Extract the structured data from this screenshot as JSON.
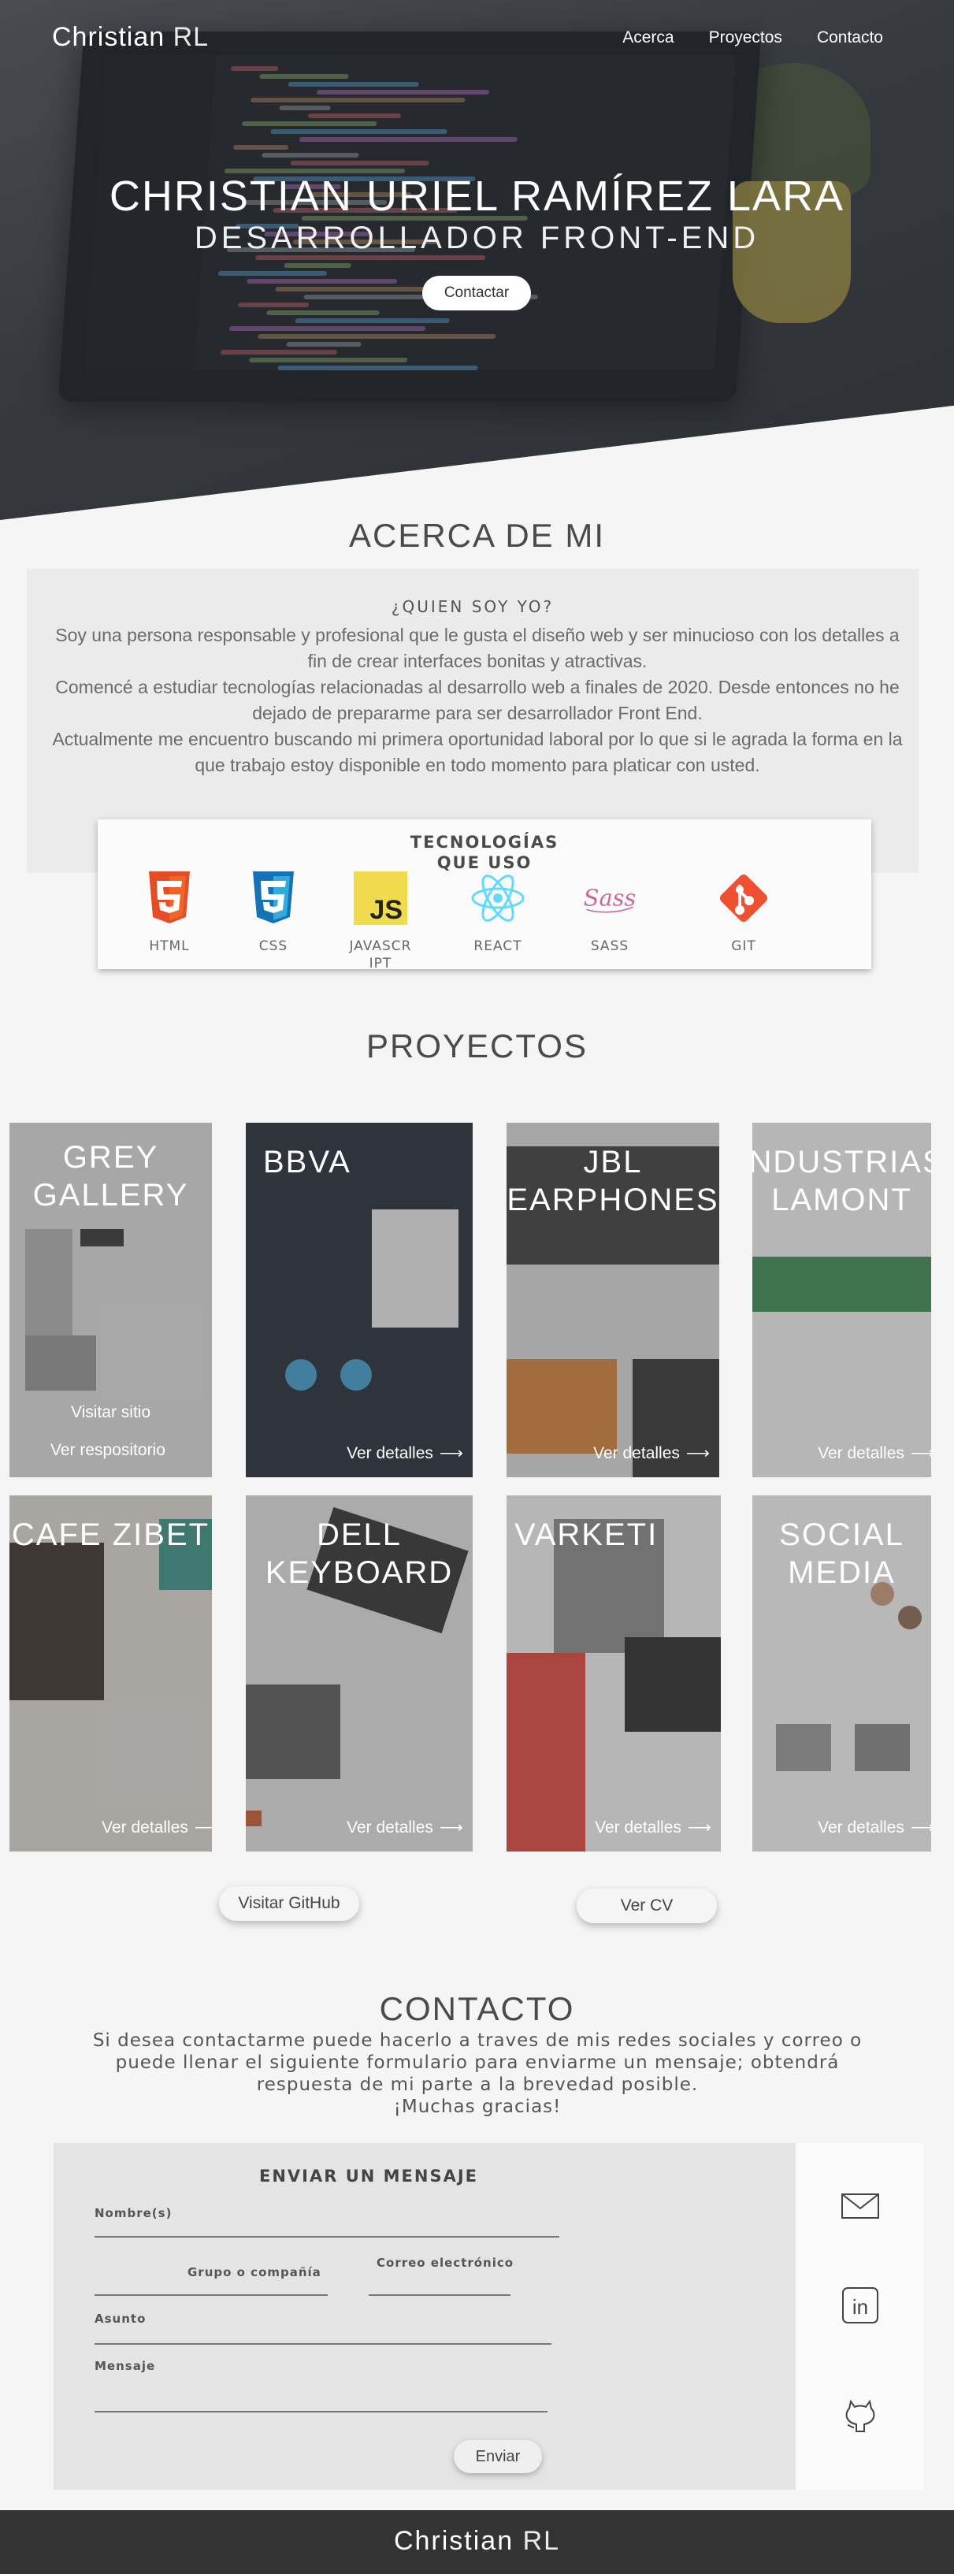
{
  "nav": {
    "brand_bold": "Christian",
    "brand_light": "RL",
    "links": [
      "Acerca",
      "Proyectos",
      "Contacto"
    ]
  },
  "hero": {
    "name": "CHRISTIAN URIEL RAMÍREZ LARA",
    "role": "DESARROLLADOR FRONT-END",
    "button": "Contactar"
  },
  "about": {
    "title": "ACERCA DE MI",
    "subtitle": "¿QUIEN SOY YO?",
    "paragraphs": [
      "Soy una persona responsable y profesional que le gusta el diseño web y ser minucioso con los detalles a fin de crear interfaces bonitas y atractivas.",
      "Comencé a estudiar tecnologías relacionadas al desarrollo web a finales de 2020. Desde entonces no he dejado de prepararme para ser desarrollador Front End.",
      "Actualmente me encuentro buscando mi primera oportunidad laboral por lo que si le agrada la forma en la que trabajo estoy disponible en todo momento para platicar con usted."
    ]
  },
  "tech": {
    "title": "TECNOLOGÍAS QUE USO",
    "items": [
      {
        "label": "HTML",
        "icon": "html5-icon",
        "color": "#e44d26"
      },
      {
        "label": "CSS",
        "icon": "css3-icon",
        "color": "#1572b6"
      },
      {
        "label": "JAVASCRIPT",
        "icon": "javascript-icon",
        "color": "#f0db4f"
      },
      {
        "label": "REACT",
        "icon": "react-icon",
        "color": "#61dafb"
      },
      {
        "label": "SASS",
        "icon": "sass-icon",
        "color": "#cd6799"
      },
      {
        "label": "GIT",
        "icon": "git-icon",
        "color": "#f05032"
      }
    ]
  },
  "projects": {
    "title": "PROYECTOS",
    "cards": [
      {
        "title": "GREY GALLERY",
        "link1": "Visitar sitio",
        "link2": "Ver respositorio"
      },
      {
        "title": "BBVA",
        "details": "Ver detalles"
      },
      {
        "title": "JBL EARPHONES",
        "details": "Ver detalles"
      },
      {
        "title": "INDUSTRIAS LAMONT",
        "details": "Ver detalles"
      },
      {
        "title": "CAFE ZIBET",
        "details": "Ver detalles"
      },
      {
        "title": "DELL KEYBOARD",
        "details": "Ver detalles"
      },
      {
        "title": "VARKETI",
        "details": "Ver detalles"
      },
      {
        "title": "SOCIAL MEDIA",
        "details": "Ver detalles"
      }
    ],
    "github_button": "Visitar GitHub",
    "cv_button": "Ver CV"
  },
  "contact": {
    "title": "CONTACTO",
    "text_lines": [
      "Si desea contactarme puede hacerlo a traves de mis redes sociales y correo o",
      "puede llenar el siguiente formulario para enviarme un mensaje; obtendrá",
      "respuesta de mi parte a la brevedad posible.",
      "¡Muchas gracias!"
    ],
    "form": {
      "title": "ENVIAR UN MENSAJE",
      "name_label": "Nombre(s)",
      "company_label": "Grupo o compañía",
      "email_label": "Correo electrónico",
      "subject_label": "Asunto",
      "message_label": "Mensaje",
      "send_button": "Enviar"
    },
    "social": [
      "mail-icon",
      "linkedin-icon",
      "github-icon"
    ]
  },
  "footer": {
    "brand_bold": "Christian",
    "brand_light": "RL"
  }
}
